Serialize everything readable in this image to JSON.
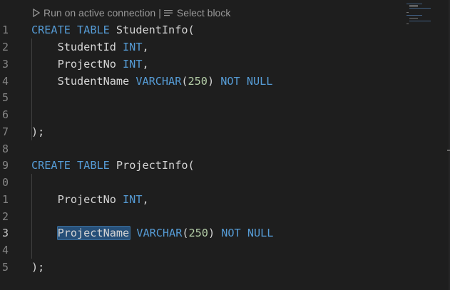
{
  "codelens": {
    "run_label": "Run on active connection",
    "separator": "|",
    "select_label": "Select block"
  },
  "line_numbers": [
    "1",
    "2",
    "3",
    "4",
    "5",
    "6",
    "7",
    "8",
    "9",
    "0",
    "1",
    "2",
    "3",
    "4",
    "5"
  ],
  "active_line_index": 12,
  "code": {
    "l1": {
      "kw1": "CREATE",
      "kw2": "TABLE",
      "name": "StudentInfo("
    },
    "l2": {
      "id": "StudentId",
      "type": "INT",
      "punc": ","
    },
    "l3": {
      "id": "ProjectNo",
      "type": "INT",
      "punc": ","
    },
    "l4": {
      "id": "StudentName",
      "type": "VARCHAR",
      "open": "(",
      "num": "250",
      "close": ")",
      "kw1": "NOT",
      "kw2": "NULL"
    },
    "l7": {
      "punc": ");"
    },
    "l9": {
      "kw1": "CREATE",
      "kw2": "TABLE",
      "name": "ProjectInfo("
    },
    "l11": {
      "id": "ProjectNo",
      "type": "INT",
      "punc": ","
    },
    "l13": {
      "id": "ProjectName",
      "type": "VARCHAR",
      "open": "(",
      "num": "250",
      "close": ")",
      "kw1": "NOT",
      "kw2": "NULL"
    },
    "l15": {
      "punc": ");"
    }
  },
  "colors": {
    "background": "#1e1e1e",
    "keyword": "#569cd6",
    "identifier": "#d4d4d4",
    "number": "#b5cea8",
    "selection": "#264f78"
  }
}
